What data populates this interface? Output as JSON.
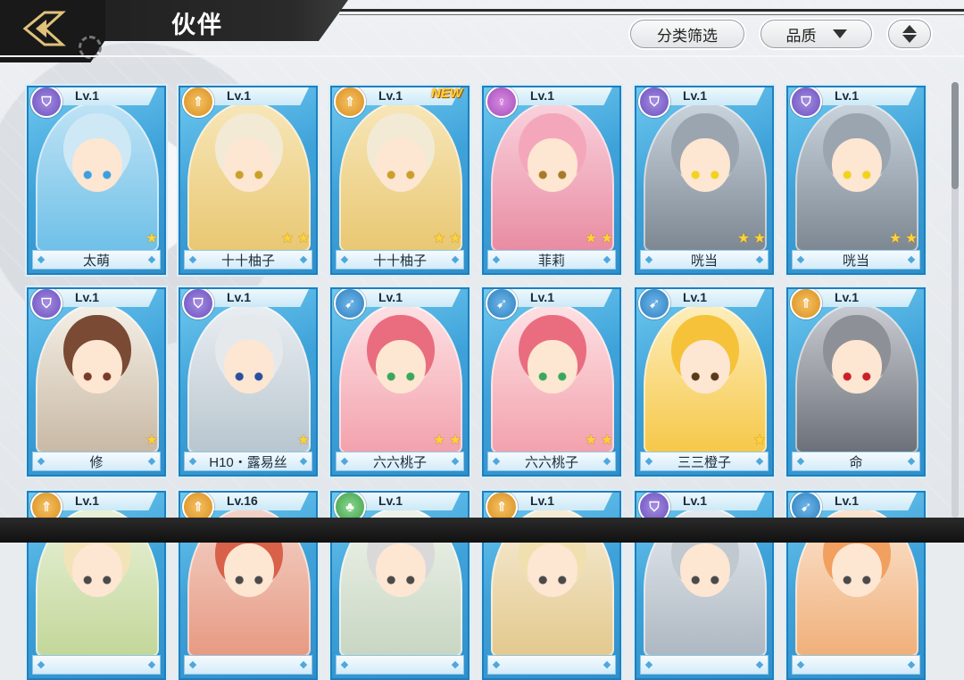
{
  "header": {
    "title": "伙伴",
    "filter_label": "分类筛选",
    "quality_label": "品质"
  },
  "colors": {
    "card_blue": "#3fa3da",
    "header_dark": "#1f1f1f",
    "star_gold": "#ffd23a",
    "new_badge": "#ffd23a"
  },
  "companions": [
    {
      "level": "Lv.1",
      "name": "太萌",
      "class_icon": "shield-icon",
      "stars": 1,
      "new": ""
    },
    {
      "level": "Lv.1",
      "name": "十十柚子",
      "class_icon": "arrow-up-icon",
      "stars": 2,
      "new": ""
    },
    {
      "level": "Lv.1",
      "name": "十十柚子",
      "class_icon": "arrow-up-icon",
      "stars": 2,
      "new": "NEW"
    },
    {
      "level": "Lv.1",
      "name": "菲莉",
      "class_icon": "staff-icon",
      "stars": 2,
      "new": ""
    },
    {
      "level": "Lv.1",
      "name": "咣当",
      "class_icon": "shield-icon",
      "stars": 2,
      "new": ""
    },
    {
      "level": "Lv.1",
      "name": "咣当",
      "class_icon": "shield-icon",
      "stars": 2,
      "new": ""
    },
    {
      "level": "Lv.1",
      "name": "修",
      "class_icon": "shield-icon",
      "stars": 1,
      "new": ""
    },
    {
      "level": "Lv.1",
      "name": "H10・露易丝",
      "class_icon": "shield-icon",
      "stars": 1,
      "new": ""
    },
    {
      "level": "Lv.1",
      "name": "六六桃子",
      "class_icon": "bow-icon",
      "stars": 2,
      "new": ""
    },
    {
      "level": "Lv.1",
      "name": "六六桃子",
      "class_icon": "bow-icon",
      "stars": 2,
      "new": ""
    },
    {
      "level": "Lv.1",
      "name": "三三橙子",
      "class_icon": "bow-icon",
      "stars": 1,
      "new": ""
    },
    {
      "level": "Lv.1",
      "name": "命",
      "class_icon": "arrow-up-icon",
      "stars": 0,
      "new": ""
    },
    {
      "level": "Lv.1",
      "name": "",
      "class_icon": "arrow-up-icon",
      "stars": 0,
      "new": ""
    },
    {
      "level": "Lv.16",
      "name": "",
      "class_icon": "arrow-up-icon",
      "stars": 0,
      "new": ""
    },
    {
      "level": "Lv.1",
      "name": "",
      "class_icon": "clover-icon",
      "stars": 0,
      "new": ""
    },
    {
      "level": "Lv.1",
      "name": "",
      "class_icon": "arrow-up-icon",
      "stars": 0,
      "new": ""
    },
    {
      "level": "Lv.1",
      "name": "",
      "class_icon": "shield-icon",
      "stars": 0,
      "new": ""
    },
    {
      "level": "Lv.1",
      "name": "",
      "class_icon": "bow-icon",
      "stars": 0,
      "new": ""
    }
  ]
}
